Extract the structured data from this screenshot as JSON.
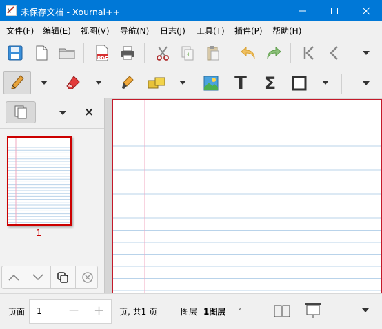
{
  "window": {
    "title": "未保存文档 - Xournal++",
    "minimize_icon": "minimize-icon",
    "maximize_icon": "maximize-icon",
    "close_icon": "close-icon",
    "titlebar_color": "#0078d7"
  },
  "menu": {
    "items": [
      {
        "label": "文件(F)"
      },
      {
        "label": "编辑(E)"
      },
      {
        "label": "视图(V)"
      },
      {
        "label": "导航(N)"
      },
      {
        "label": "日志(J)"
      },
      {
        "label": "工具(T)"
      },
      {
        "label": "插件(P)"
      },
      {
        "label": "帮助(H)"
      }
    ]
  },
  "toolbar_main": {
    "icons": [
      "save-icon",
      "new-document-icon",
      "open-folder-icon",
      "export-pdf-icon",
      "print-icon",
      "cut-icon",
      "copy-icon",
      "paste-icon",
      "undo-icon",
      "redo-icon",
      "go-first-page-icon",
      "previous-page-icon",
      "toolbar-menu-icon"
    ],
    "pdf_label": "PDF"
  },
  "toolbar_tools": {
    "icons": [
      "pen-icon",
      "eraser-icon",
      "highlighter-icon",
      "select-region-icon",
      "image-icon",
      "text-tool-icon",
      "latex-sigma-icon",
      "shape-rectangle-icon",
      "toolbar-menu-icon"
    ],
    "text_tool_glyph": "T",
    "latex_glyph": "Σ"
  },
  "sidebar": {
    "page_label": "1",
    "close_glyph": "×"
  },
  "status": {
    "page_prefix": "页面",
    "page_value": "1",
    "minus_glyph": "—",
    "plus_glyph": "+",
    "page_suffix": "页, 共1 页",
    "layer_prefix": "图层",
    "layer_value": "1图层",
    "layer_chevron": "˅"
  },
  "colors": {
    "accent_red": "#cc0000",
    "page_border": "#c41a2a",
    "ruled_line": "#b9d3ea",
    "margin_line": "#f0a8c0"
  }
}
